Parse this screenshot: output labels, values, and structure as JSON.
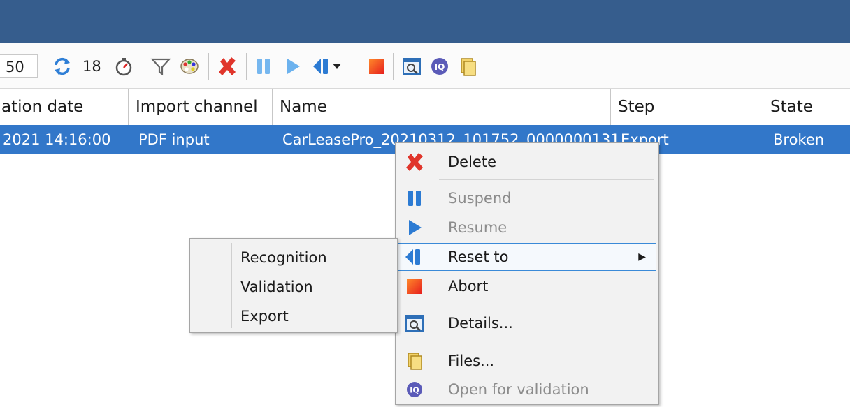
{
  "toolbar": {
    "page_value": "50",
    "refresh_count": "18",
    "icons": [
      "refresh-icon",
      "timer-icon",
      "filter-icon",
      "palette-icon",
      "delete-icon",
      "suspend-icon",
      "resume-icon",
      "reset-to-icon",
      "abort-icon",
      "details-icon",
      "open-validation-icon",
      "files-icon"
    ]
  },
  "table": {
    "columns": [
      "ation date",
      "Import channel",
      "Name",
      "Step",
      "State"
    ],
    "rows": [
      {
        "date": "2021  14:16:00",
        "channel": "PDF input",
        "name": "CarLeasePro_20210312_101752_0000000131",
        "step": "Export",
        "state": "Broken"
      }
    ]
  },
  "context_menu": {
    "items": [
      {
        "label": "Delete",
        "icon": "delete-icon",
        "enabled": true
      },
      {
        "label": "Suspend",
        "icon": "suspend-icon",
        "enabled": false
      },
      {
        "label": "Resume",
        "icon": "resume-icon",
        "enabled": false
      },
      {
        "label": "Reset to",
        "icon": "reset-to-icon",
        "enabled": true,
        "has_submenu": true
      },
      {
        "label": "Abort",
        "icon": "abort-icon",
        "enabled": true
      },
      {
        "label": "Details...",
        "icon": "details-icon",
        "enabled": true
      },
      {
        "label": "Files...",
        "icon": "files-icon",
        "enabled": true
      },
      {
        "label": "Open for validation",
        "icon": "open-validation-icon",
        "enabled": false
      }
    ],
    "submenu_arrow": "▶"
  },
  "reset_submenu": {
    "items": [
      "Recognition",
      "Validation",
      "Export"
    ]
  },
  "colors": {
    "titlebar": "#365d8d",
    "selection": "#3277c9",
    "menu_bg": "#f2f2f2",
    "hover_border": "#3a8ad8"
  }
}
